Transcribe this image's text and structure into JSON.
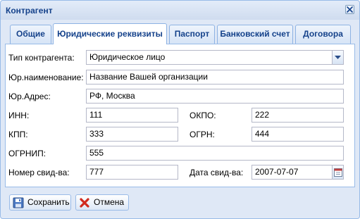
{
  "window": {
    "title": "Контрагент"
  },
  "tabs": [
    {
      "label": "Общие"
    },
    {
      "label": "Юридические реквизиты"
    },
    {
      "label": "Паспорт"
    },
    {
      "label": "Банковский счет"
    },
    {
      "label": "Договора"
    }
  ],
  "form": {
    "type": {
      "label": "Тип контрагента:",
      "value": "Юридическое лицо"
    },
    "name": {
      "label": "Юр.наименование:",
      "value": "Название Вашей организации"
    },
    "address": {
      "label": "Юр.Адрес:",
      "value": "РФ, Москва"
    },
    "inn": {
      "label": "ИНН:",
      "value": "111"
    },
    "okpo": {
      "label": "ОКПО:",
      "value": "222"
    },
    "kpp": {
      "label": "КПП:",
      "value": "333"
    },
    "ogrn": {
      "label": "ОГРН:",
      "value": "444"
    },
    "ogrnip": {
      "label": "ОГРНИП:",
      "value": "555"
    },
    "cert_number": {
      "label": "Номер свид-ва:",
      "value": "777"
    },
    "cert_date": {
      "label": "Дата свид-ва:",
      "value": "2007-07-07"
    }
  },
  "buttons": {
    "save": "Сохранить",
    "cancel": "Отмена"
  },
  "icons": {
    "close": "close-icon",
    "combo": "chevron-down-icon",
    "date": "calendar-icon",
    "save": "floppy-disk-icon",
    "cancel": "red-cross-icon"
  },
  "colors": {
    "title_text": "#15428b",
    "window_bg": "#dfe8f6",
    "border": "#99bbe8"
  }
}
